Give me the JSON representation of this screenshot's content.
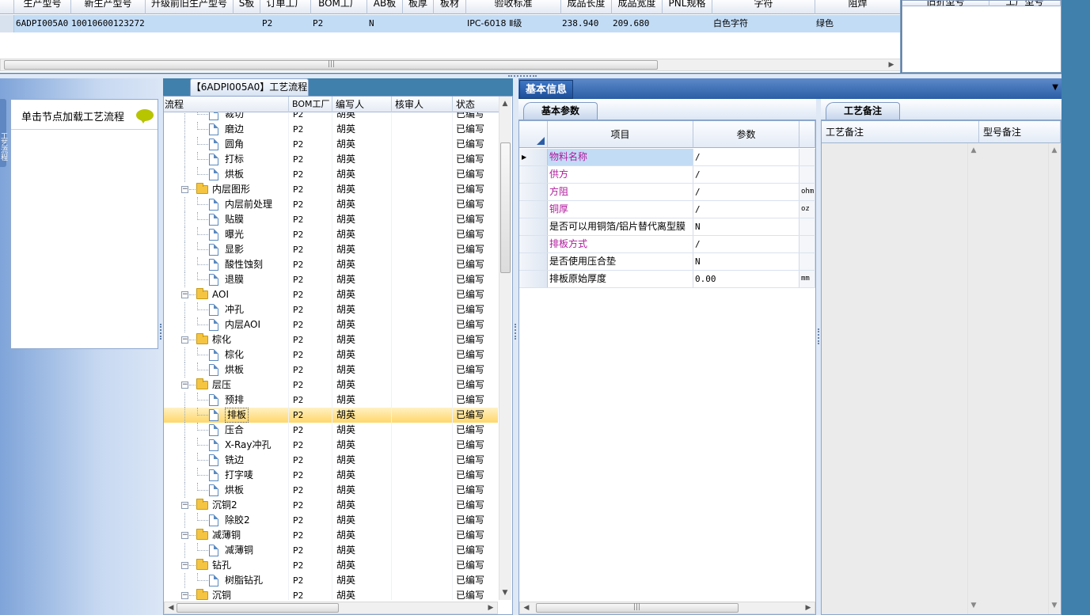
{
  "top_grid": {
    "columns": [
      "生产型号",
      "新生产型号",
      "升级前旧生产型号",
      "S板",
      "订单工厂",
      "BOM工厂",
      "AB板",
      "板厚",
      "板材",
      "验收标准",
      "成品长度",
      "成品宽度",
      "PNL规格",
      "字符",
      "阻焊"
    ],
    "row": {
      "prod_model": "6ADPI005A0",
      "new_model": "10010600123272",
      "old_model": "",
      "s_board": "",
      "order_factory": "P2",
      "bom_factory": "P2",
      "ab_board": "N",
      "thickness": "",
      "material": "",
      "standard": "IPC-6018 Ⅱ级",
      "length": "238.940",
      "width": "209.680",
      "pnl": "",
      "character": "白色字符",
      "solder_mask": "绿色"
    }
  },
  "right_mini_headers": [
    "旧折型号",
    "工厂型号"
  ],
  "left_panel": {
    "load_hint": "单击节点加载工艺流程",
    "side_label": "工艺流程"
  },
  "tree": {
    "tab_title": "【6ADPI005A0】工艺流程",
    "columns": [
      "流程",
      "BOM工厂",
      "编写人",
      "核审人",
      "状态"
    ],
    "rows": [
      {
        "name": "裁切",
        "level": 1,
        "bom": "P2",
        "writer": "胡英",
        "reviewer": "",
        "status": "已编写"
      },
      {
        "name": "磨边",
        "level": 1,
        "bom": "P2",
        "writer": "胡英",
        "reviewer": "",
        "status": "已编写"
      },
      {
        "name": "圆角",
        "level": 1,
        "bom": "P2",
        "writer": "胡英",
        "reviewer": "",
        "status": "已编写"
      },
      {
        "name": "打标",
        "level": 1,
        "bom": "P2",
        "writer": "胡英",
        "reviewer": "",
        "status": "已编写"
      },
      {
        "name": "烘板",
        "level": 1,
        "bom": "P2",
        "writer": "胡英",
        "reviewer": "",
        "status": "已编写"
      },
      {
        "name": "内层图形",
        "level": 0,
        "bom": "P2",
        "writer": "胡英",
        "reviewer": "",
        "status": "已编写"
      },
      {
        "name": "内层前处理",
        "level": 1,
        "bom": "P2",
        "writer": "胡英",
        "reviewer": "",
        "status": "已编写"
      },
      {
        "name": "贴膜",
        "level": 1,
        "bom": "P2",
        "writer": "胡英",
        "reviewer": "",
        "status": "已编写"
      },
      {
        "name": "曝光",
        "level": 1,
        "bom": "P2",
        "writer": "胡英",
        "reviewer": "",
        "status": "已编写"
      },
      {
        "name": "显影",
        "level": 1,
        "bom": "P2",
        "writer": "胡英",
        "reviewer": "",
        "status": "已编写"
      },
      {
        "name": "酸性蚀刻",
        "level": 1,
        "bom": "P2",
        "writer": "胡英",
        "reviewer": "",
        "status": "已编写"
      },
      {
        "name": "退膜",
        "level": 1,
        "bom": "P2",
        "writer": "胡英",
        "reviewer": "",
        "status": "已编写"
      },
      {
        "name": "AOI",
        "level": 0,
        "bom": "P2",
        "writer": "胡英",
        "reviewer": "",
        "status": "已编写"
      },
      {
        "name": "冲孔",
        "level": 1,
        "bom": "P2",
        "writer": "胡英",
        "reviewer": "",
        "status": "已编写"
      },
      {
        "name": "内层AOI",
        "level": 1,
        "bom": "P2",
        "writer": "胡英",
        "reviewer": "",
        "status": "已编写"
      },
      {
        "name": "棕化",
        "level": 0,
        "bom": "P2",
        "writer": "胡英",
        "reviewer": "",
        "status": "已编写"
      },
      {
        "name": "棕化",
        "level": 1,
        "bom": "P2",
        "writer": "胡英",
        "reviewer": "",
        "status": "已编写"
      },
      {
        "name": "烘板",
        "level": 1,
        "bom": "P2",
        "writer": "胡英",
        "reviewer": "",
        "status": "已编写"
      },
      {
        "name": "层压",
        "level": 0,
        "bom": "P2",
        "writer": "胡英",
        "reviewer": "",
        "status": "已编写"
      },
      {
        "name": "预排",
        "level": 1,
        "bom": "P2",
        "writer": "胡英",
        "reviewer": "",
        "status": "已编写"
      },
      {
        "name": "排板",
        "level": 1,
        "bom": "P2",
        "writer": "胡英",
        "reviewer": "",
        "status": "已编写",
        "selected": true
      },
      {
        "name": "压合",
        "level": 1,
        "bom": "P2",
        "writer": "胡英",
        "reviewer": "",
        "status": "已编写"
      },
      {
        "name": "X-Ray冲孔",
        "level": 1,
        "bom": "P2",
        "writer": "胡英",
        "reviewer": "",
        "status": "已编写"
      },
      {
        "name": "铣边",
        "level": 1,
        "bom": "P2",
        "writer": "胡英",
        "reviewer": "",
        "status": "已编写"
      },
      {
        "name": "打字唛",
        "level": 1,
        "bom": "P2",
        "writer": "胡英",
        "reviewer": "",
        "status": "已编写"
      },
      {
        "name": "烘板",
        "level": 1,
        "bom": "P2",
        "writer": "胡英",
        "reviewer": "",
        "status": "已编写"
      },
      {
        "name": "沉铜2",
        "level": 0,
        "bom": "P2",
        "writer": "胡英",
        "reviewer": "",
        "status": "已编写"
      },
      {
        "name": "除胶2",
        "level": 1,
        "bom": "P2",
        "writer": "胡英",
        "reviewer": "",
        "status": "已编写"
      },
      {
        "name": "减薄铜",
        "level": 0,
        "bom": "P2",
        "writer": "胡英",
        "reviewer": "",
        "status": "已编写"
      },
      {
        "name": "减薄铜",
        "level": 1,
        "bom": "P2",
        "writer": "胡英",
        "reviewer": "",
        "status": "已编写"
      },
      {
        "name": "钻孔",
        "level": 0,
        "bom": "P2",
        "writer": "胡英",
        "reviewer": "",
        "status": "已编写"
      },
      {
        "name": "树脂钻孔",
        "level": 1,
        "bom": "P2",
        "writer": "胡英",
        "reviewer": "",
        "status": "已编写"
      },
      {
        "name": "沉铜",
        "level": 0,
        "bom": "P2",
        "writer": "胡英",
        "reviewer": "",
        "status": "已编写"
      }
    ]
  },
  "basic_info": {
    "tab_label": "基本信息",
    "sub_tab": "基本参数",
    "columns": [
      "项目",
      "参数"
    ],
    "rows": [
      {
        "item": "物料名称",
        "value": "/",
        "unit": "",
        "highlight": true,
        "current": true
      },
      {
        "item": "供方",
        "value": "/",
        "unit": "",
        "highlight": true
      },
      {
        "item": "方阻",
        "value": "/",
        "unit": "ohm",
        "highlight": true
      },
      {
        "item": "铜厚",
        "value": "/",
        "unit": "oz",
        "highlight": true
      },
      {
        "item": "是否可以用铜箔/铝片替代离型膜",
        "value": "N",
        "unit": "",
        "highlight": false
      },
      {
        "item": "排板方式",
        "value": "/",
        "unit": "",
        "highlight": true
      },
      {
        "item": "是否使用压合垫",
        "value": "N",
        "unit": "",
        "highlight": false
      },
      {
        "item": "排板原始厚度",
        "value": "0.00",
        "unit": "mm",
        "highlight": false
      }
    ]
  },
  "remarks": {
    "tab_label": "工艺备注",
    "columns": [
      "工艺备注",
      "型号备注"
    ]
  },
  "colors": {
    "selection": "#c3dcf6",
    "tree_selected": "#ffd76a",
    "accent_blue": "#2b5ea6",
    "magenta": "#b0189c"
  }
}
